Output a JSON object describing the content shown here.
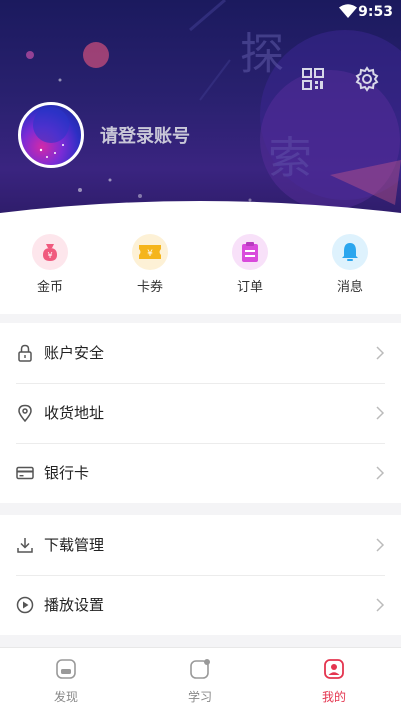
{
  "status_bar": {
    "time": "9:53"
  },
  "header": {
    "deco_text_1": "探",
    "deco_text_2": "索",
    "login_text": "请登录账号"
  },
  "quick_actions": [
    {
      "label": "金币",
      "icon": "money-bag-icon",
      "color": "#f05a7e"
    },
    {
      "label": "卡券",
      "icon": "ticket-icon",
      "color": "#f5b51c"
    },
    {
      "label": "订单",
      "icon": "order-clipboard-icon",
      "color": "#d94adc"
    },
    {
      "label": "消息",
      "icon": "bell-icon",
      "color": "#2ba6ee"
    }
  ],
  "menu_group_1": [
    {
      "label": "账户安全",
      "icon": "lock-icon"
    },
    {
      "label": "收货地址",
      "icon": "location-pin-icon"
    },
    {
      "label": "银行卡",
      "icon": "bank-card-icon"
    }
  ],
  "menu_group_2": [
    {
      "label": "下载管理",
      "icon": "download-icon"
    },
    {
      "label": "播放设置",
      "icon": "play-circle-icon"
    }
  ],
  "tabbar": {
    "active_color": "#e4354f",
    "tabs": [
      {
        "label": "发现",
        "icon": "discover-icon"
      },
      {
        "label": "学习",
        "icon": "study-icon"
      },
      {
        "label": "我的",
        "icon": "profile-icon",
        "active": true
      }
    ]
  }
}
